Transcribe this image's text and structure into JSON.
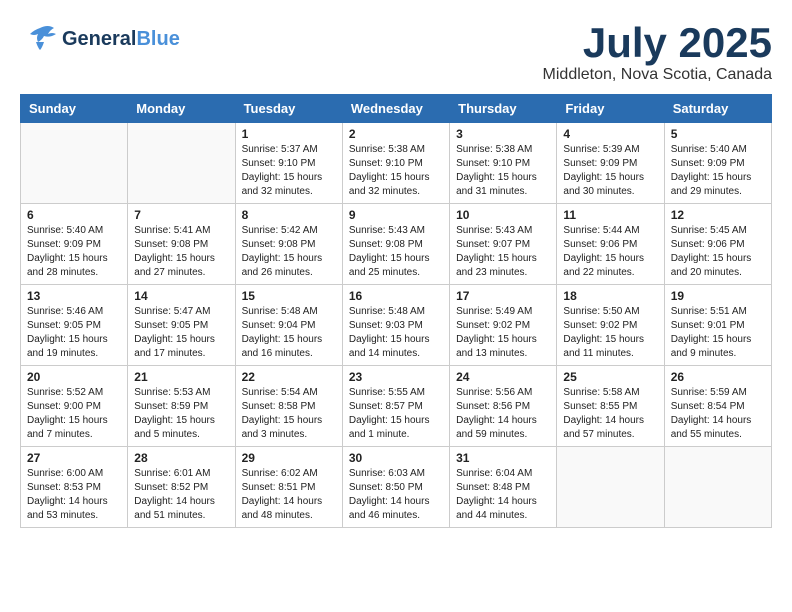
{
  "header": {
    "logo_general": "General",
    "logo_blue": "Blue",
    "month": "July 2025",
    "location": "Middleton, Nova Scotia, Canada"
  },
  "weekdays": [
    "Sunday",
    "Monday",
    "Tuesday",
    "Wednesday",
    "Thursday",
    "Friday",
    "Saturday"
  ],
  "weeks": [
    [
      {
        "day": "",
        "info": ""
      },
      {
        "day": "",
        "info": ""
      },
      {
        "day": "1",
        "info": "Sunrise: 5:37 AM\nSunset: 9:10 PM\nDaylight: 15 hours\nand 32 minutes."
      },
      {
        "day": "2",
        "info": "Sunrise: 5:38 AM\nSunset: 9:10 PM\nDaylight: 15 hours\nand 32 minutes."
      },
      {
        "day": "3",
        "info": "Sunrise: 5:38 AM\nSunset: 9:10 PM\nDaylight: 15 hours\nand 31 minutes."
      },
      {
        "day": "4",
        "info": "Sunrise: 5:39 AM\nSunset: 9:09 PM\nDaylight: 15 hours\nand 30 minutes."
      },
      {
        "day": "5",
        "info": "Sunrise: 5:40 AM\nSunset: 9:09 PM\nDaylight: 15 hours\nand 29 minutes."
      }
    ],
    [
      {
        "day": "6",
        "info": "Sunrise: 5:40 AM\nSunset: 9:09 PM\nDaylight: 15 hours\nand 28 minutes."
      },
      {
        "day": "7",
        "info": "Sunrise: 5:41 AM\nSunset: 9:08 PM\nDaylight: 15 hours\nand 27 minutes."
      },
      {
        "day": "8",
        "info": "Sunrise: 5:42 AM\nSunset: 9:08 PM\nDaylight: 15 hours\nand 26 minutes."
      },
      {
        "day": "9",
        "info": "Sunrise: 5:43 AM\nSunset: 9:08 PM\nDaylight: 15 hours\nand 25 minutes."
      },
      {
        "day": "10",
        "info": "Sunrise: 5:43 AM\nSunset: 9:07 PM\nDaylight: 15 hours\nand 23 minutes."
      },
      {
        "day": "11",
        "info": "Sunrise: 5:44 AM\nSunset: 9:06 PM\nDaylight: 15 hours\nand 22 minutes."
      },
      {
        "day": "12",
        "info": "Sunrise: 5:45 AM\nSunset: 9:06 PM\nDaylight: 15 hours\nand 20 minutes."
      }
    ],
    [
      {
        "day": "13",
        "info": "Sunrise: 5:46 AM\nSunset: 9:05 PM\nDaylight: 15 hours\nand 19 minutes."
      },
      {
        "day": "14",
        "info": "Sunrise: 5:47 AM\nSunset: 9:05 PM\nDaylight: 15 hours\nand 17 minutes."
      },
      {
        "day": "15",
        "info": "Sunrise: 5:48 AM\nSunset: 9:04 PM\nDaylight: 15 hours\nand 16 minutes."
      },
      {
        "day": "16",
        "info": "Sunrise: 5:48 AM\nSunset: 9:03 PM\nDaylight: 15 hours\nand 14 minutes."
      },
      {
        "day": "17",
        "info": "Sunrise: 5:49 AM\nSunset: 9:02 PM\nDaylight: 15 hours\nand 13 minutes."
      },
      {
        "day": "18",
        "info": "Sunrise: 5:50 AM\nSunset: 9:02 PM\nDaylight: 15 hours\nand 11 minutes."
      },
      {
        "day": "19",
        "info": "Sunrise: 5:51 AM\nSunset: 9:01 PM\nDaylight: 15 hours\nand 9 minutes."
      }
    ],
    [
      {
        "day": "20",
        "info": "Sunrise: 5:52 AM\nSunset: 9:00 PM\nDaylight: 15 hours\nand 7 minutes."
      },
      {
        "day": "21",
        "info": "Sunrise: 5:53 AM\nSunset: 8:59 PM\nDaylight: 15 hours\nand 5 minutes."
      },
      {
        "day": "22",
        "info": "Sunrise: 5:54 AM\nSunset: 8:58 PM\nDaylight: 15 hours\nand 3 minutes."
      },
      {
        "day": "23",
        "info": "Sunrise: 5:55 AM\nSunset: 8:57 PM\nDaylight: 15 hours\nand 1 minute."
      },
      {
        "day": "24",
        "info": "Sunrise: 5:56 AM\nSunset: 8:56 PM\nDaylight: 14 hours\nand 59 minutes."
      },
      {
        "day": "25",
        "info": "Sunrise: 5:58 AM\nSunset: 8:55 PM\nDaylight: 14 hours\nand 57 minutes."
      },
      {
        "day": "26",
        "info": "Sunrise: 5:59 AM\nSunset: 8:54 PM\nDaylight: 14 hours\nand 55 minutes."
      }
    ],
    [
      {
        "day": "27",
        "info": "Sunrise: 6:00 AM\nSunset: 8:53 PM\nDaylight: 14 hours\nand 53 minutes."
      },
      {
        "day": "28",
        "info": "Sunrise: 6:01 AM\nSunset: 8:52 PM\nDaylight: 14 hours\nand 51 minutes."
      },
      {
        "day": "29",
        "info": "Sunrise: 6:02 AM\nSunset: 8:51 PM\nDaylight: 14 hours\nand 48 minutes."
      },
      {
        "day": "30",
        "info": "Sunrise: 6:03 AM\nSunset: 8:50 PM\nDaylight: 14 hours\nand 46 minutes."
      },
      {
        "day": "31",
        "info": "Sunrise: 6:04 AM\nSunset: 8:48 PM\nDaylight: 14 hours\nand 44 minutes."
      },
      {
        "day": "",
        "info": ""
      },
      {
        "day": "",
        "info": ""
      }
    ]
  ]
}
